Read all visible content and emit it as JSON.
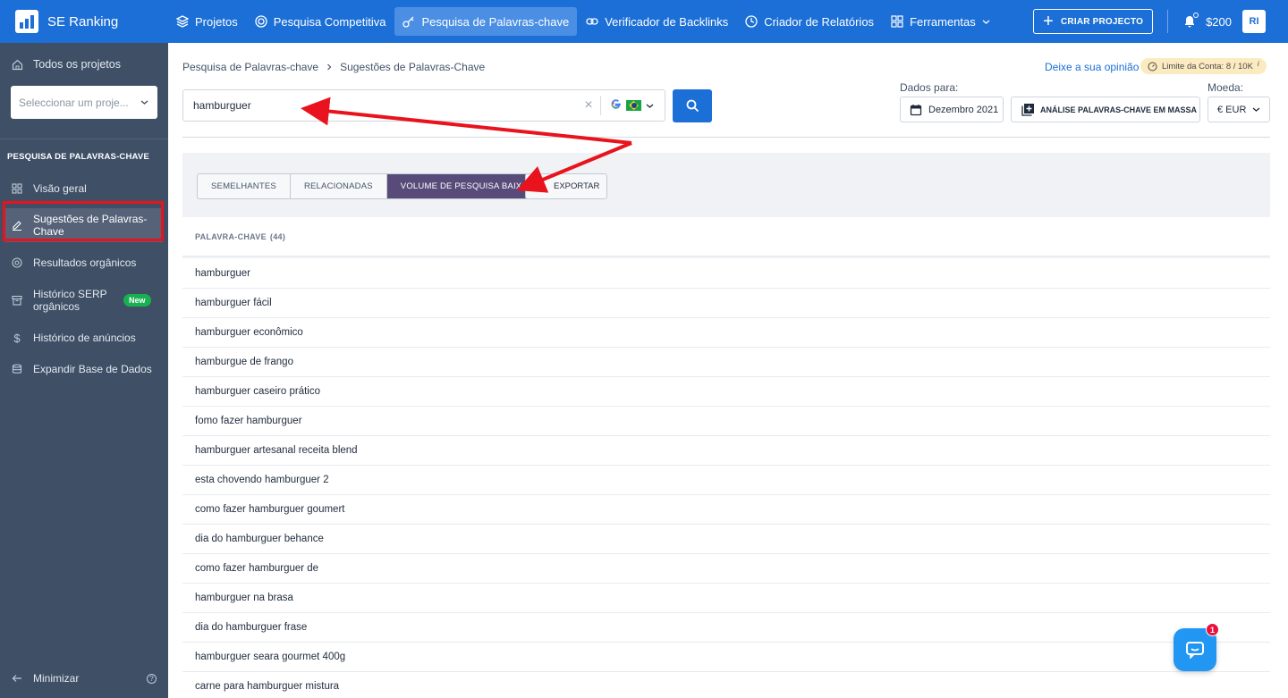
{
  "app": {
    "name": "SE Ranking",
    "nav": [
      {
        "label": "Projetos",
        "icon": "layers-icon"
      },
      {
        "label": "Pesquisa Competitiva",
        "icon": "target-icon"
      },
      {
        "label": "Pesquisa de Palavras-chave",
        "icon": "key-icon",
        "active": true
      },
      {
        "label": "Verificador de Backlinks",
        "icon": "link-icon"
      },
      {
        "label": "Criador de Relatórios",
        "icon": "clock-icon"
      },
      {
        "label": "Ferramentas",
        "icon": "grid-icon"
      }
    ],
    "create_label": "CRIAR PROJECTO",
    "balance": "$200",
    "avatar": "RI"
  },
  "sidebar": {
    "all_projects": "Todos os projetos",
    "select_placeholder": "Seleccionar um proje...",
    "section_title": "PESQUISA DE PALAVRAS-CHAVE",
    "items": [
      {
        "label": "Visão geral",
        "icon": "grid-icon"
      },
      {
        "label": "Sugestões de Palavras-Chave",
        "icon": "edit-icon",
        "active": true
      },
      {
        "label": "Resultados orgânicos",
        "icon": "target-icon"
      },
      {
        "label": "Histórico SERP orgânicos",
        "icon": "archive-icon",
        "badge": "New"
      },
      {
        "label": "Histórico de anúncios",
        "icon": "dollar-icon"
      },
      {
        "label": "Expandir Base de Dados",
        "icon": "database-icon"
      }
    ],
    "minimize": "Minimizar"
  },
  "main": {
    "breadcrumb": [
      "Pesquisa de Palavras-chave",
      "Sugestões de Palavras-Chave"
    ],
    "feedback": "Deixe a sua opinião",
    "limit": "Limite da Conta: 8 / 10K",
    "search_value": "hamburguer",
    "data_label": "Dados para:",
    "date": "Dezembro 2021",
    "bulk_label": "ANÁLISE PALAVRAS-CHAVE EM MASSA",
    "currency_label": "Moeda:",
    "currency": "€ EUR",
    "tabs": [
      "SEMELHANTES",
      "RELACIONADAS",
      "VOLUME DE PESQUISA BAIXO"
    ],
    "export_label": "EXPORTAR",
    "column_header": "PALAVRA-CHAVE",
    "column_count": "(44)",
    "keywords": [
      "hamburguer",
      "hamburguer fácil",
      "hamburguer econômico",
      "hamburgue de frango",
      "hamburguer caseiro prático",
      "fomo fazer hamburguer",
      "hamburguer artesanal receita blend",
      "esta chovendo hamburguer 2",
      "como fazer hamburguer goumert",
      "dia do hamburguer behance",
      "como fazer hamburguer de",
      "hamburguer na brasa",
      "dia do hamburguer frase",
      "hamburguer seara gourmet 400g",
      "carne para hamburguer mistura"
    ],
    "chat_badge": "1"
  },
  "colors": {
    "topbar": "#1b6fd6",
    "sidebar": "#3e4f66",
    "active_tab": "#584b7a",
    "annotation": "#e8131c"
  }
}
